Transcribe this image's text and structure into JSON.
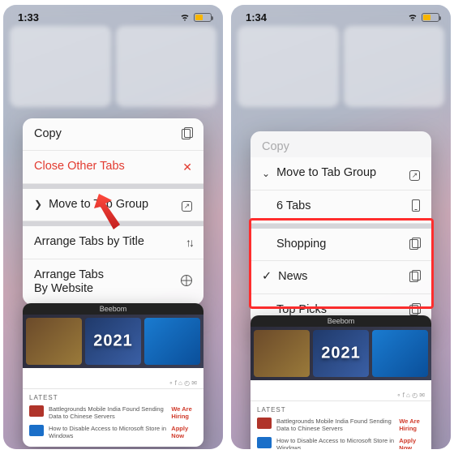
{
  "left": {
    "time": "1:33",
    "menu": {
      "copy": "Copy",
      "close_other": "Close Other Tabs",
      "move": "Move to Tab Group",
      "arrange_title": "Arrange Tabs by Title",
      "arrange_site_l1": "Arrange Tabs",
      "arrange_site_l2": "By Website"
    }
  },
  "right": {
    "time": "1:34",
    "menu": {
      "copy": "Copy",
      "move": "Move to Tab Group",
      "tabs_count": "6 Tabs",
      "groups": [
        "Shopping",
        "News",
        "Top Picks"
      ],
      "selected_index": 1
    }
  },
  "tabcard": {
    "site": "Beebom",
    "hero_year": "2021",
    "latest_label": "LATEST",
    "items": [
      "Battlegrounds Mobile India Found Sending Data to Chinese Servers",
      "How to Disable Access to Microsoft Store in Windows"
    ],
    "hiring": "We Are Hiring",
    "apply": "Apply Now"
  },
  "colors": {
    "destructive": "#e23b30",
    "highlight": "#ff2d2d",
    "battery": "#f7b500"
  }
}
